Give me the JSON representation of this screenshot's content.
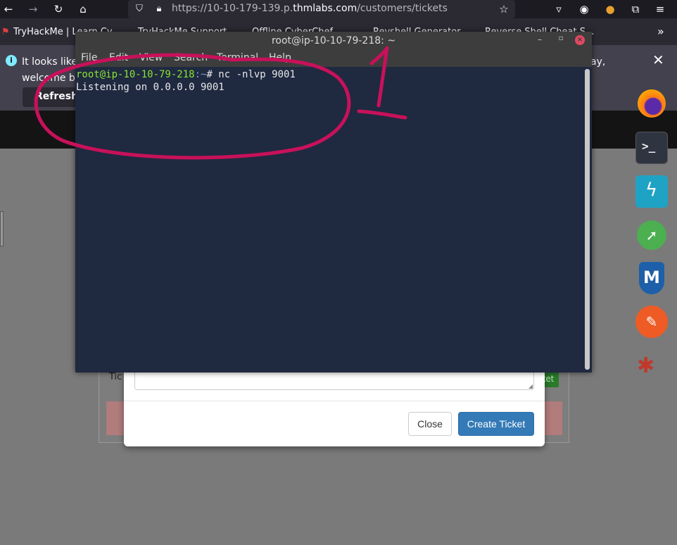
{
  "browser": {
    "url_prefix": "https://10-10-179-139.p.",
    "url_domain": "thmlabs.com",
    "url_path": "/customers/tickets"
  },
  "bookmarks": [
    {
      "label": "TryHackMe | Learn Cy..."
    },
    {
      "label": "TryHackMe Support"
    },
    {
      "label": "Offline CyberChef"
    },
    {
      "label": "Revshell Generator"
    },
    {
      "label": "Reverse Shell Cheat S..."
    }
  ],
  "infobar": {
    "text_left": "It looks like",
    "text_right": "ay,",
    "text_line2": "welcome ba",
    "refresh_label": "Refresh"
  },
  "terminal": {
    "title": "root@ip-10-10-79-218: ~",
    "menu": [
      "File",
      "Edit",
      "View",
      "Search",
      "Terminal",
      "Help"
    ],
    "prompt_user": "root@ip-10-10-79-218",
    "prompt_path": ":~",
    "prompt_symbol": "# ",
    "command": "nc -nlvp 9001",
    "output": "Listening on 0.0.0.0 9001"
  },
  "page": {
    "ticket_label": "Tic",
    "green_button_fragment": "ket"
  },
  "modal": {
    "close_label": "Close",
    "create_label": "Create Ticket"
  },
  "annotation": {
    "label": "1",
    "color": "#c8115a"
  },
  "colors": {
    "terminal_bg": "#1f2940",
    "prompt_green": "#8ae234",
    "primary_blue": "#337ab7"
  }
}
